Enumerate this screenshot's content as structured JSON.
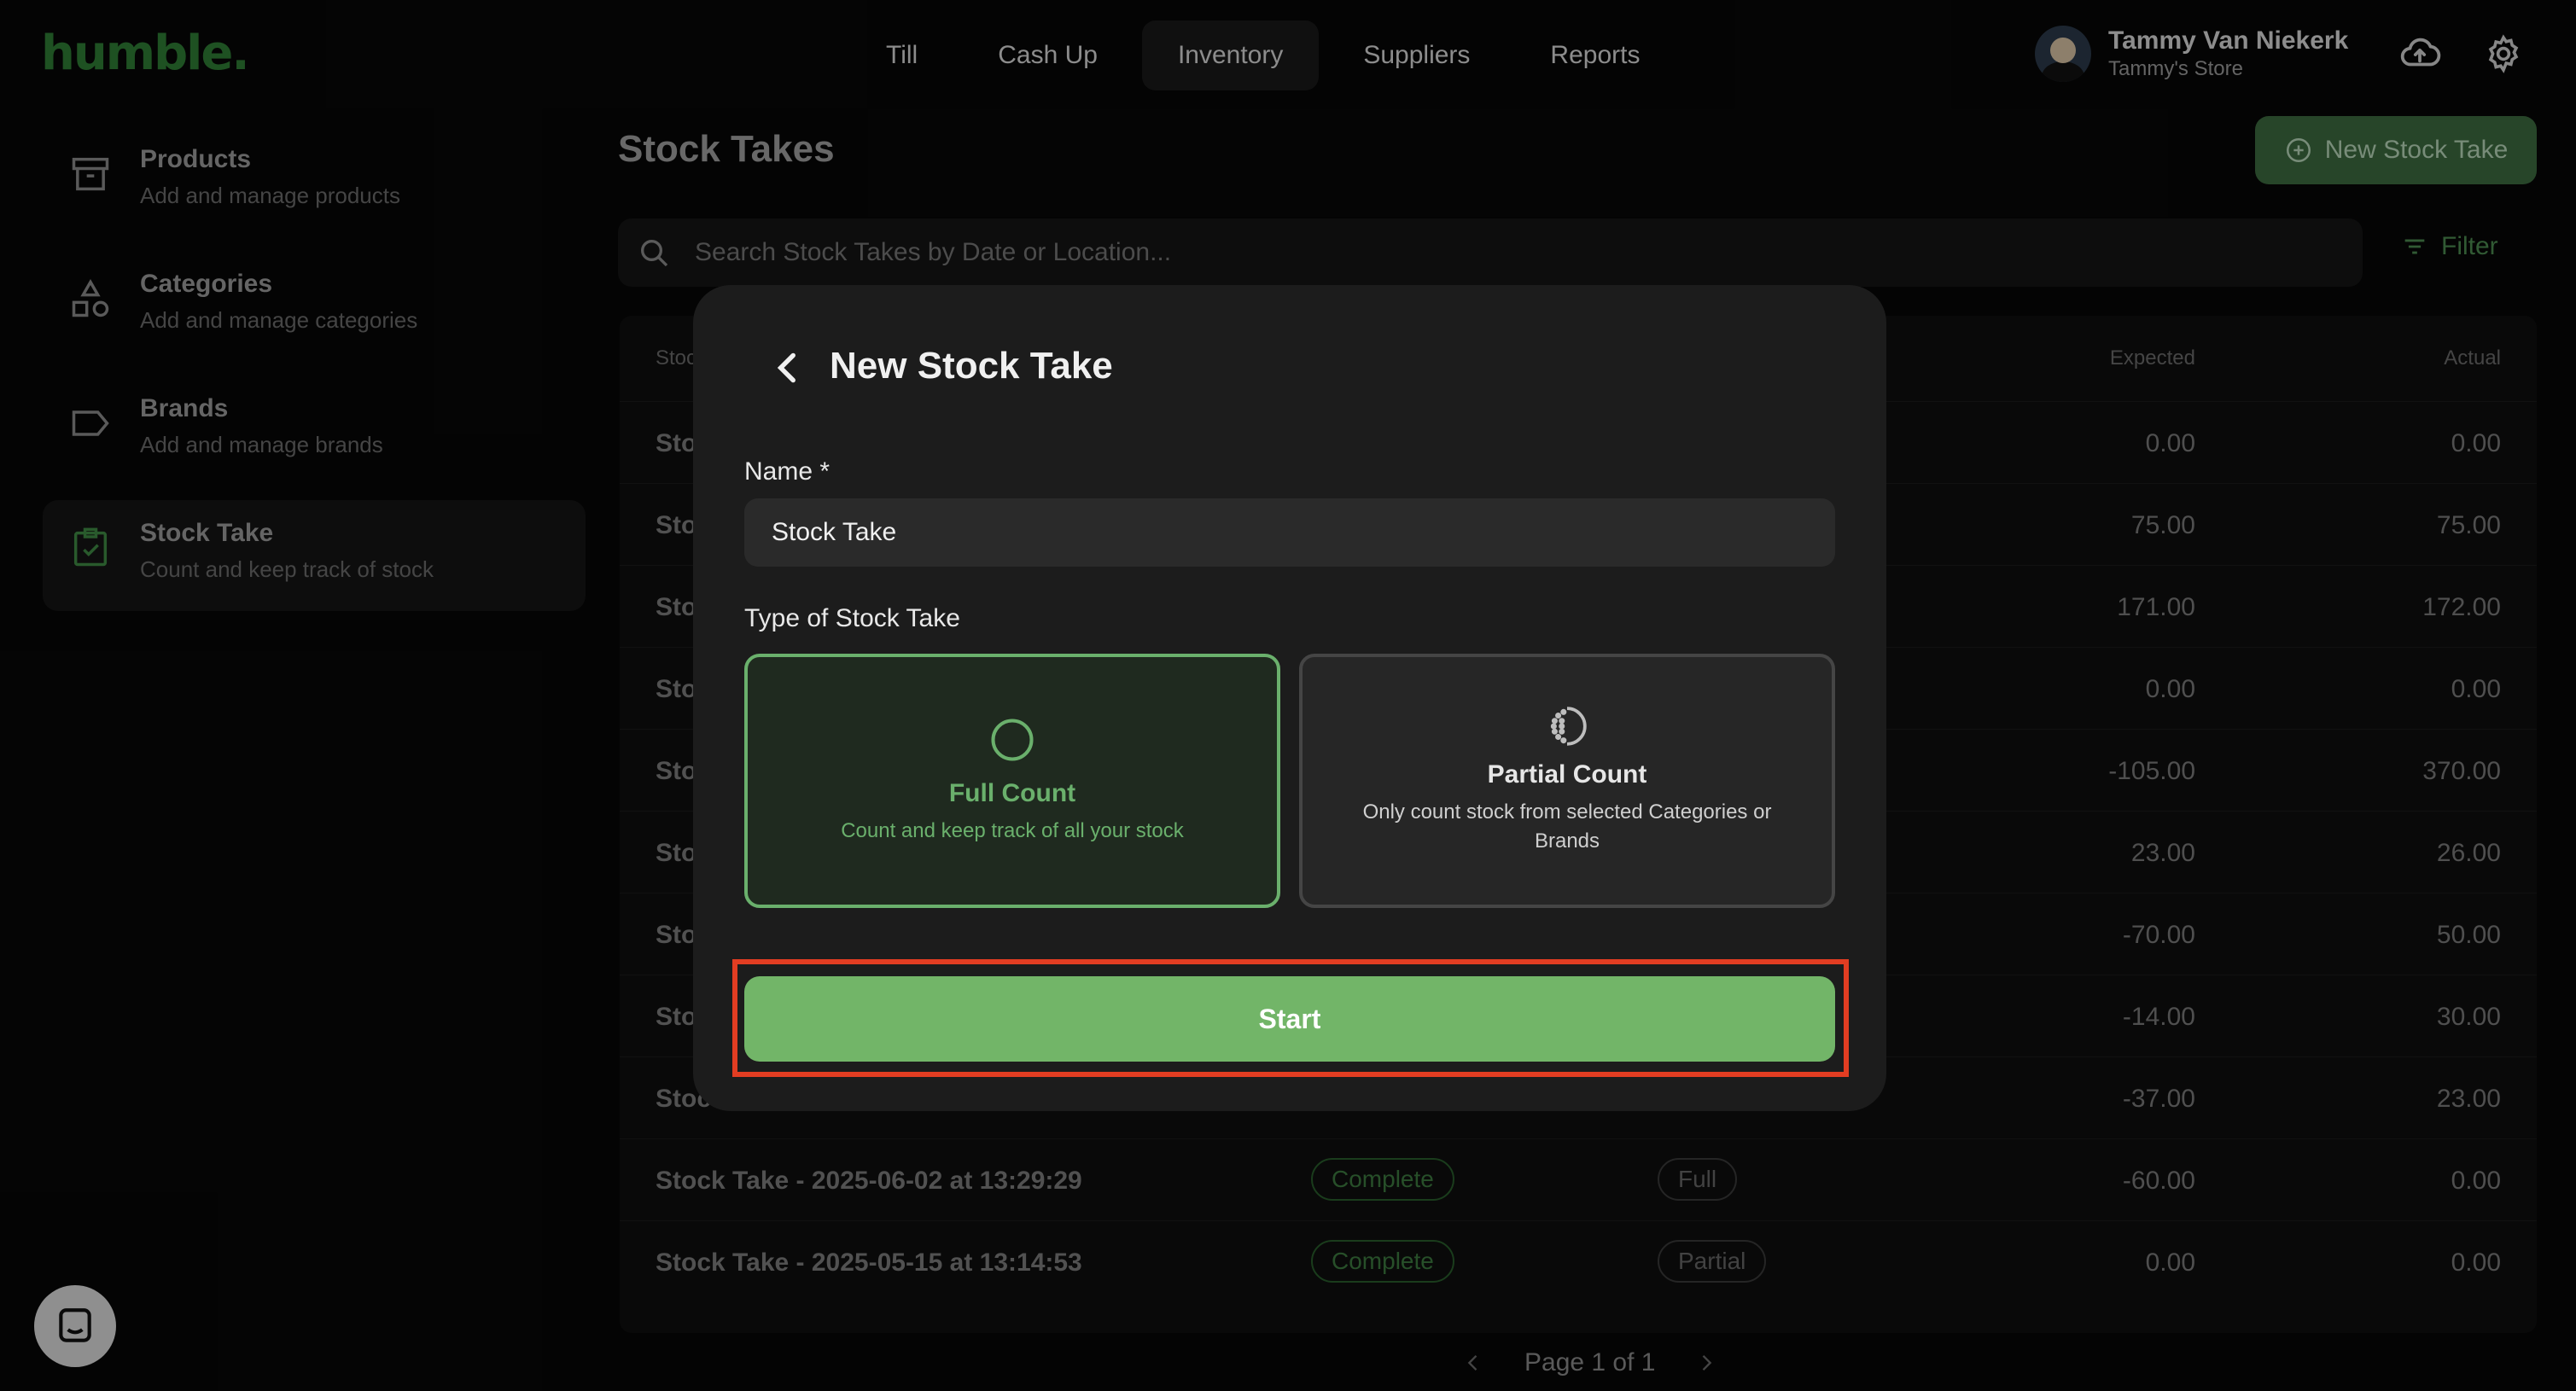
{
  "app": {
    "logo": "humble."
  },
  "nav": {
    "tabs": [
      {
        "label": "Till"
      },
      {
        "label": "Cash Up"
      },
      {
        "label": "Inventory"
      },
      {
        "label": "Suppliers"
      },
      {
        "label": "Reports"
      }
    ]
  },
  "user": {
    "name": "Tammy Van Niekerk",
    "store": "Tammy's Store"
  },
  "sidebar": {
    "items": [
      {
        "title": "Products",
        "subtitle": "Add and manage products"
      },
      {
        "title": "Categories",
        "subtitle": "Add and manage categories"
      },
      {
        "title": "Brands",
        "subtitle": "Add and manage brands"
      },
      {
        "title": "Stock Take",
        "subtitle": "Count and keep track of stock"
      }
    ]
  },
  "main": {
    "title": "Stock Takes",
    "new_button": "New Stock Take",
    "search_placeholder": "Search Stock Takes by Date or Location...",
    "filter_label": "Filter",
    "table": {
      "headers": {
        "name": "Stoc",
        "expected": "Expected",
        "actual": "Actual"
      },
      "rows": [
        {
          "name": "Sto",
          "status": "",
          "type": "",
          "expected": "0.00",
          "actual": "0.00"
        },
        {
          "name": "Sto",
          "status": "",
          "type": "",
          "expected": "75.00",
          "actual": "75.00"
        },
        {
          "name": "Sto",
          "status": "",
          "type": "",
          "expected": "171.00",
          "actual": "172.00"
        },
        {
          "name": "Sto",
          "status": "",
          "type": "",
          "expected": "0.00",
          "actual": "0.00"
        },
        {
          "name": "Sto",
          "status": "",
          "type": "",
          "expected": "-105.00",
          "actual": "370.00"
        },
        {
          "name": "Sto",
          "status": "",
          "type": "",
          "expected": "23.00",
          "actual": "26.00"
        },
        {
          "name": "Sto",
          "status": "",
          "type": "",
          "expected": "-70.00",
          "actual": "50.00"
        },
        {
          "name": "Sto",
          "status": "",
          "type": "",
          "expected": "-14.00",
          "actual": "30.00"
        },
        {
          "name": "Stoc",
          "status": "",
          "type": "",
          "expected": "-37.00",
          "actual": "23.00"
        },
        {
          "name": "Stock Take - 2025-06-02 at 13:29:29",
          "status": "Complete",
          "type": "Full",
          "expected": "-60.00",
          "actual": "0.00"
        },
        {
          "name": "Stock Take - 2025-05-15 at 13:14:53",
          "status": "Complete",
          "type": "Partial",
          "expected": "0.00",
          "actual": "0.00"
        }
      ]
    },
    "pager": "Page 1 of 1"
  },
  "modal": {
    "title": "New Stock Take",
    "name_label": "Name *",
    "name_value": "Stock Take",
    "type_label": "Type of Stock Take",
    "options": {
      "full": {
        "title": "Full Count",
        "desc": "Count and keep track of all your stock"
      },
      "partial": {
        "title": "Partial Count",
        "desc": "Only count stock from selected Categories or Brands"
      }
    },
    "selected": "full",
    "start_label": "Start"
  },
  "colors": {
    "accent": "#72b568",
    "brand": "#2f7d35",
    "highlight": "#e23d22"
  }
}
